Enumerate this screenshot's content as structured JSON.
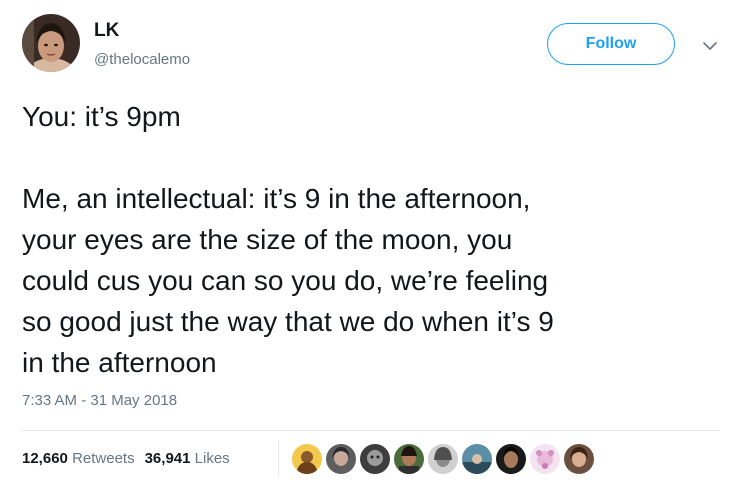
{
  "tweet": {
    "author": {
      "display_name": "LK",
      "handle": "@thelocalemo",
      "avatar_icon": "profile-photo-avatar"
    },
    "follow_label": "Follow",
    "menu_icon": "chevron-down-icon",
    "text": {
      "line1": "You: it’s 9pm",
      "line2": "Me, an intellectual: it’s 9 in the afternoon,\nyour eyes are the size of the moon, you\ncould cus you can so you do, we’re feeling\nso good just the way that we do when it’s 9\nin the afternoon"
    },
    "timestamp": "7:33 AM - 31 May 2018",
    "stats": {
      "retweets_count": "12,660",
      "retweets_label": "Retweets",
      "likes_count": "36,941",
      "likes_label": "Likes"
    },
    "liker_avatars": [
      "liker-avatar-1",
      "liker-avatar-2",
      "liker-avatar-3",
      "liker-avatar-4",
      "liker-avatar-5",
      "liker-avatar-6",
      "liker-avatar-7",
      "liker-avatar-8",
      "liker-avatar-9"
    ]
  },
  "colors": {
    "text_primary": "#14171a",
    "text_secondary": "#657786",
    "accent_blue": "#1da1f2",
    "divider": "#e6ecf0"
  }
}
